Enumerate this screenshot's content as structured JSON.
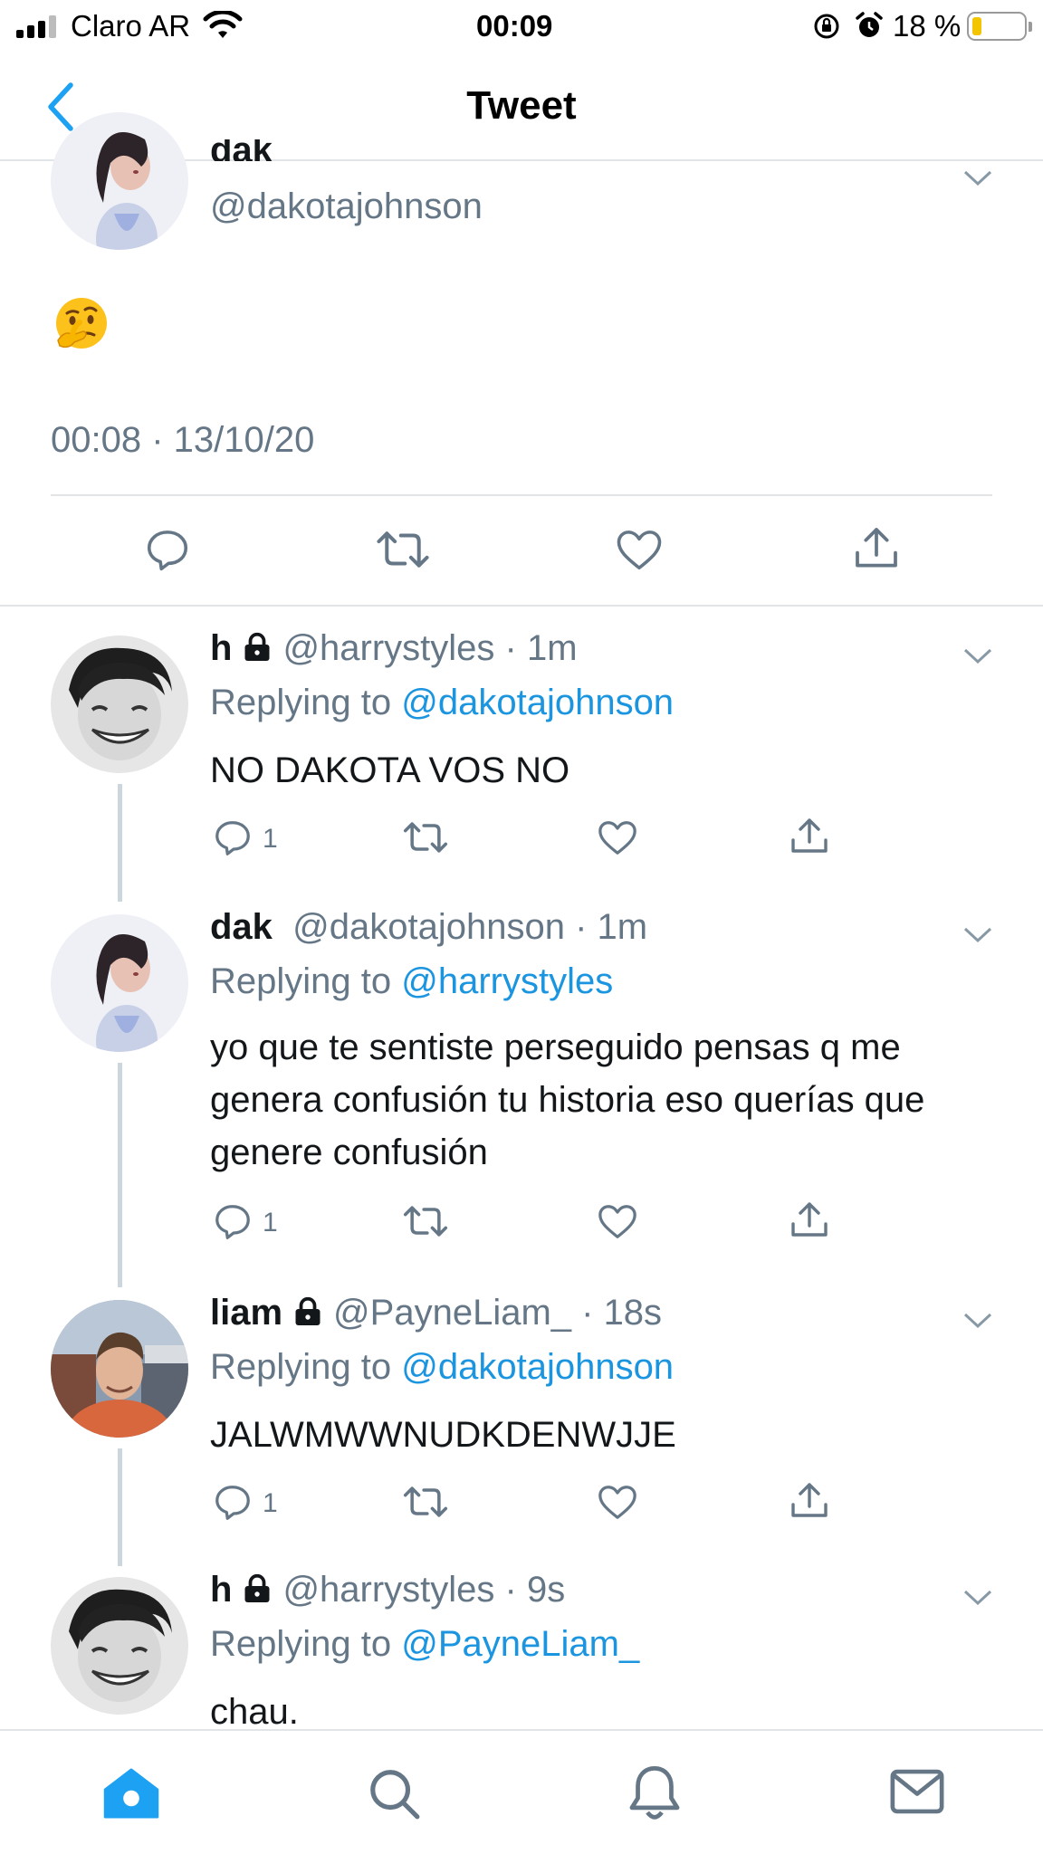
{
  "status_bar": {
    "carrier": "Claro AR",
    "time": "00:09",
    "battery": "18 %",
    "battery_level": 0.18
  },
  "nav": {
    "back_icon": "chevron-left-icon",
    "title": "Tweet"
  },
  "main_tweet": {
    "name": "dak",
    "handle": "@dakotajohnson",
    "emoji": "🤔",
    "timestamp": "00:08 · 13/10/20",
    "actions": [
      "reply-icon",
      "retweet-icon",
      "like-icon",
      "share-icon"
    ]
  },
  "replies": [
    {
      "name": "h",
      "locked": true,
      "handle": "@harrystyles",
      "time": "1m",
      "replying_prefix": "Replying to ",
      "replying_to": "@dakotajohnson",
      "text": "NO DAKOTA VOS NO",
      "reply_count": "1"
    },
    {
      "name": "dak",
      "locked": false,
      "handle": "@dakotajohnson",
      "time": "1m",
      "replying_prefix": "Replying to ",
      "replying_to": "@harrystyles",
      "text": "yo que te sentiste perseguido pensas q me genera confusión tu historia eso querías que genere confusión",
      "reply_count": "1"
    },
    {
      "name": "liam",
      "locked": true,
      "handle": "@PayneLiam_",
      "time": "18s",
      "replying_prefix": "Replying to ",
      "replying_to": "@dakotajohnson",
      "text": "JALWMWWNUDKDENWJJE",
      "reply_count": "1"
    },
    {
      "name": "h",
      "locked": true,
      "handle": "@harrystyles",
      "time": "9s",
      "replying_prefix": "Replying to ",
      "replying_to": "@PayneLiam_",
      "text": "chau."
    }
  ],
  "tab_bar": {
    "tabs": [
      "home-icon",
      "search-icon",
      "notifications-icon",
      "messages-icon"
    ],
    "active": "home-icon"
  },
  "colors": {
    "accent": "#1da1f2",
    "mention": "#1b95e0",
    "secondary_text": "#657786",
    "divider": "#e1e5e8"
  }
}
